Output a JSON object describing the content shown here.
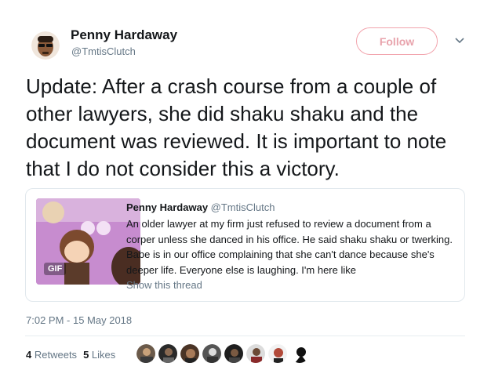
{
  "author": {
    "name": "Penny Hardaway",
    "handle": "@TmtisClutch"
  },
  "follow_label": "Follow",
  "tweet_text": "Update: After a crash course from a couple of other lawyers, she did shaku shaku and the document was reviewed. It is important to note that I do not consider this a victory.",
  "quoted": {
    "name": "Penny Hardaway",
    "handle": "@TmtisClutch",
    "text": "An older lawyer at my firm just refused to review a document from a corper unless she danced in his office. He said shaku shaku or twerking. Babe is in our office complaining that she can't dance because she's deeper life. Everyone else is laughing. I'm here like",
    "media_badge": "GIF",
    "show_thread": "Show this thread"
  },
  "timestamp": "7:02 PM - 15 May 2018",
  "stats": {
    "retweets_count": "4",
    "retweets_label": "Retweets",
    "likes_count": "5",
    "likes_label": "Likes"
  },
  "colors": {
    "accent_follow": "#e8a3ac",
    "secondary_text": "#657786",
    "primary_text": "#14171a",
    "border": "#e1e8ed"
  },
  "icons": [
    "chevron-down-icon",
    "avatar"
  ]
}
